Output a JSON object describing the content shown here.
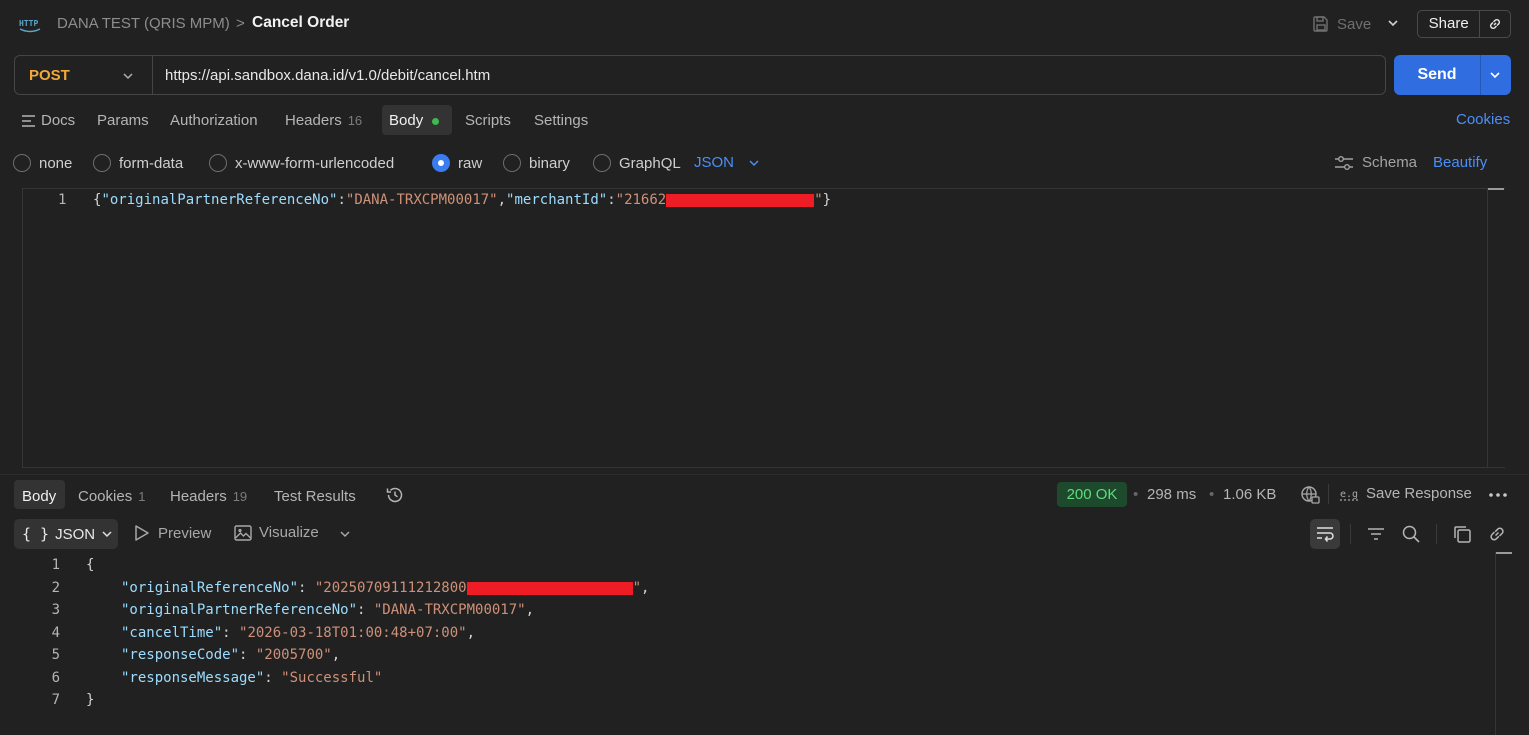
{
  "header": {
    "breadcrumb": "DANA TEST (QRIS MPM)",
    "separator": ">",
    "title": "Cancel Order",
    "save_label": "Save",
    "share_label": "Share"
  },
  "request": {
    "method": "POST",
    "url": "https://api.sandbox.dana.id/v1.0/debit/cancel.htm",
    "send_label": "Send"
  },
  "request_tabs": {
    "docs": "Docs",
    "params": "Params",
    "authorization": "Authorization",
    "headers": "Headers",
    "headers_count": "16",
    "body": "Body",
    "scripts": "Scripts",
    "settings": "Settings",
    "cookies": "Cookies"
  },
  "body_types": {
    "none": "none",
    "form_data": "form-data",
    "urlencoded": "x-www-form-urlencoded",
    "raw": "raw",
    "binary": "binary",
    "graphql": "GraphQL",
    "selected": "raw",
    "format": "JSON",
    "schema": "Schema",
    "beautify": "Beautify"
  },
  "request_body": {
    "line_no": "1",
    "open_brace": "{",
    "key1": "\"originalPartnerReferenceNo\"",
    "colon": ":",
    "val1": "\"DANA-TRXCPM00017\"",
    "comma": ",",
    "key2": "\"merchantId\"",
    "val2_prefix": "\"21662",
    "val2_suffix": "\"",
    "close_brace": "}"
  },
  "response_tabs": {
    "body": "Body",
    "cookies": "Cookies",
    "cookies_count": "1",
    "headers": "Headers",
    "headers_count": "19",
    "test_results": "Test Results"
  },
  "response_meta": {
    "status": "200 OK",
    "time": "298 ms",
    "size": "1.06 KB",
    "save_response": "Save Response",
    "status_color": "#5fdc7c"
  },
  "response_view": {
    "format": "JSON",
    "preview": "Preview",
    "visualize": "Visualize"
  },
  "response_body": {
    "line_numbers": [
      "1",
      "2",
      "3",
      "4",
      "5",
      "6",
      "7"
    ],
    "open_brace": "{",
    "close_brace": "}",
    "fields": [
      {
        "key": "\"originalReferenceNo\"",
        "value": "\"20250709111212800",
        "value_suffix": "\"",
        "trail": ",",
        "redacted": true
      },
      {
        "key": "\"originalPartnerReferenceNo\"",
        "value": "\"DANA-TRXCPM00017\"",
        "trail": ","
      },
      {
        "key": "\"cancelTime\"",
        "value": "\"2026-03-18T01:00:48+07:00\"",
        "trail": ","
      },
      {
        "key": "\"responseCode\"",
        "value": "\"2005700\"",
        "trail": ","
      },
      {
        "key": "\"responseMessage\"",
        "value": "\"Successful\"",
        "trail": ""
      }
    ]
  },
  "colors": {
    "accent": "#2f6de1",
    "link": "#4c8ef7",
    "method": "#f2a93b",
    "json_key": "#9cdcfe",
    "json_string": "#ce9178",
    "redaction": "#ee1c24"
  }
}
